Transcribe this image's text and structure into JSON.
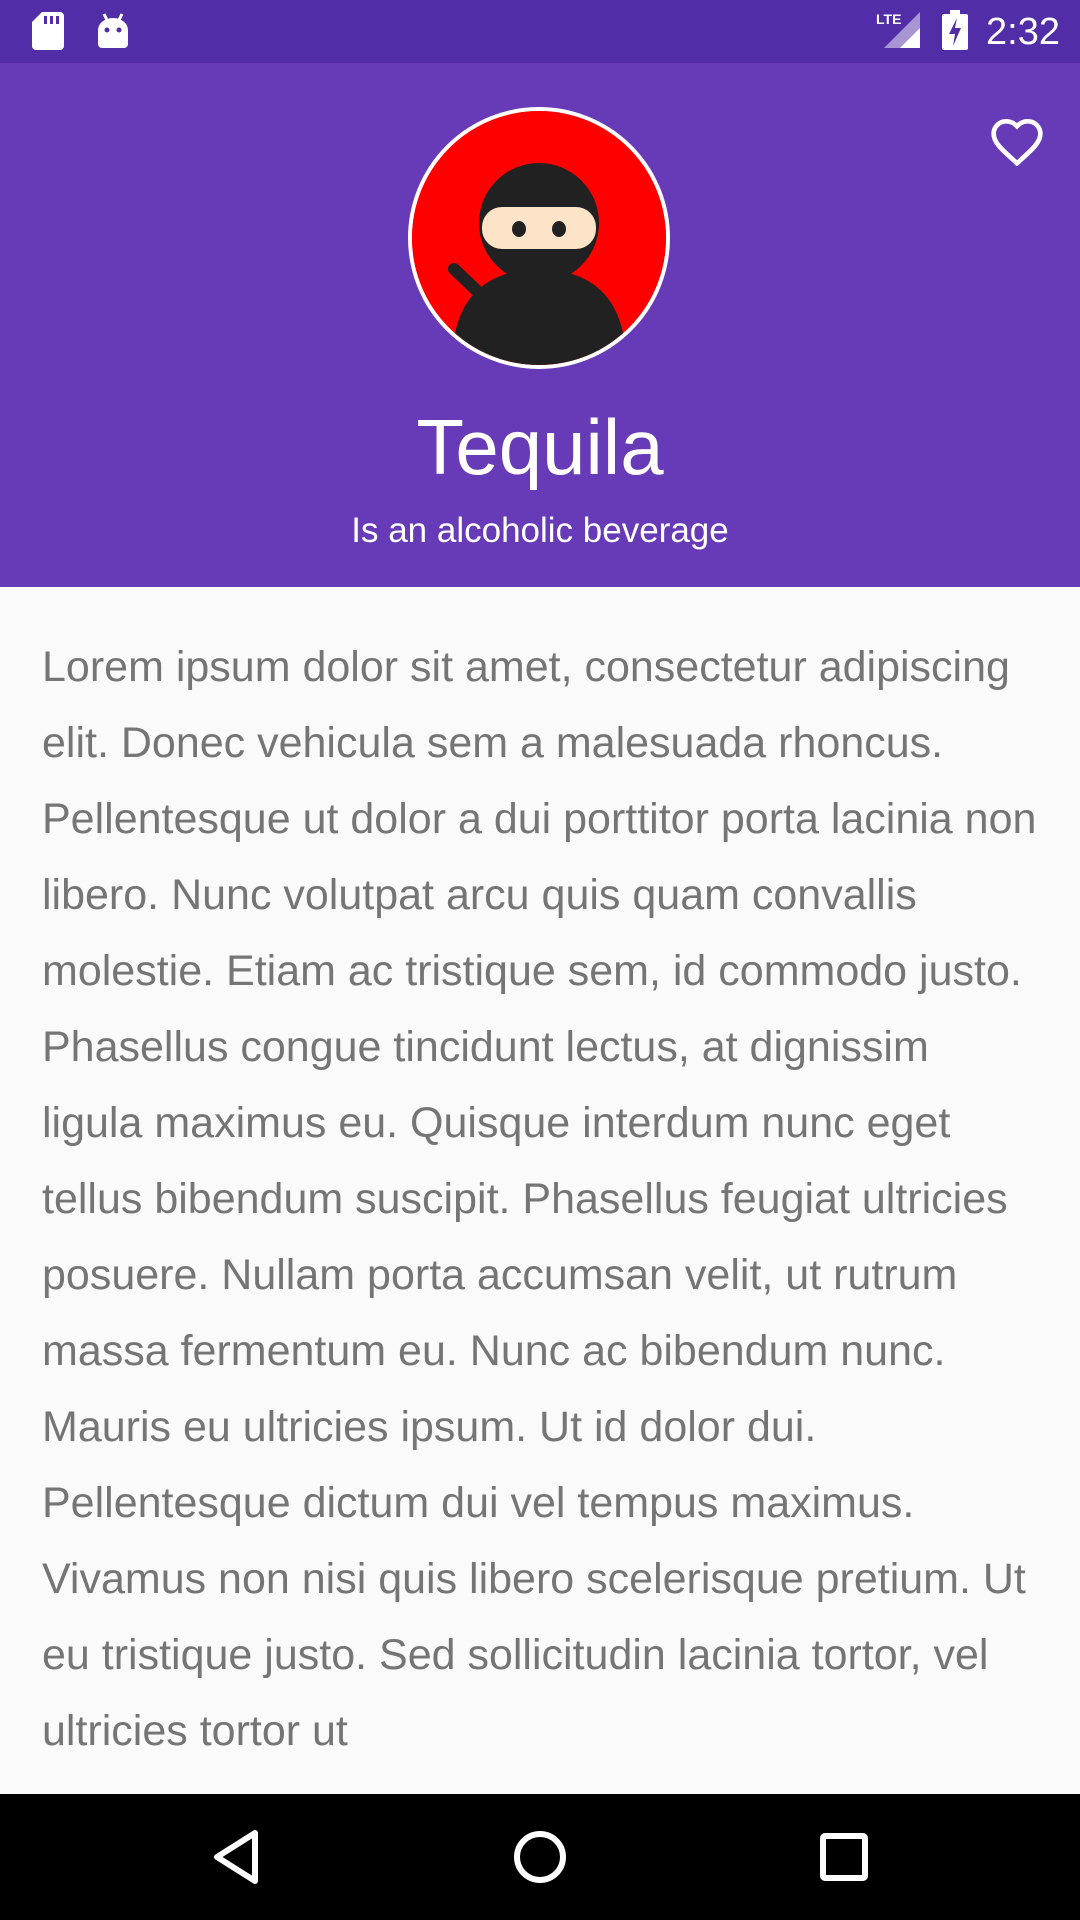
{
  "status_bar": {
    "time": "2:32",
    "network": "LTE",
    "icons_left": [
      "sd-card-icon",
      "android-icon"
    ],
    "icons_right": [
      "signal-icon",
      "battery-charging-icon"
    ]
  },
  "header": {
    "title": "Tequila",
    "subtitle": "Is an alcoholic beverage",
    "background_color": "#673ab7",
    "avatar_background": "#ff0000",
    "favorite_icon": "heart-outline-icon"
  },
  "content": {
    "body": "Lorem ipsum dolor sit amet, consectetur adipiscing elit. Donec vehicula sem a malesuada rhoncus. Pellentesque ut dolor a dui porttitor porta lacinia non libero. Nunc volutpat arcu quis quam convallis molestie. Etiam ac tristique sem, id commodo justo. Phasellus congue tincidunt lectus, at dignissim ligula maximus eu. Quisque interdum nunc eget tellus bibendum suscipit. Phasellus feugiat ultricies posuere. Nullam porta accumsan velit, ut rutrum massa fermentum eu. Nunc ac bibendum nunc. Mauris eu ultricies ipsum. Ut id dolor dui. Pellentesque dictum dui vel tempus maximus. Vivamus non nisi quis libero scelerisque pretium. Ut eu tristique justo. Sed sollicitudin lacinia tortor, vel ultricies tortor ut"
  },
  "nav_bar": {
    "buttons": [
      "back-icon",
      "home-icon",
      "recents-icon"
    ]
  }
}
